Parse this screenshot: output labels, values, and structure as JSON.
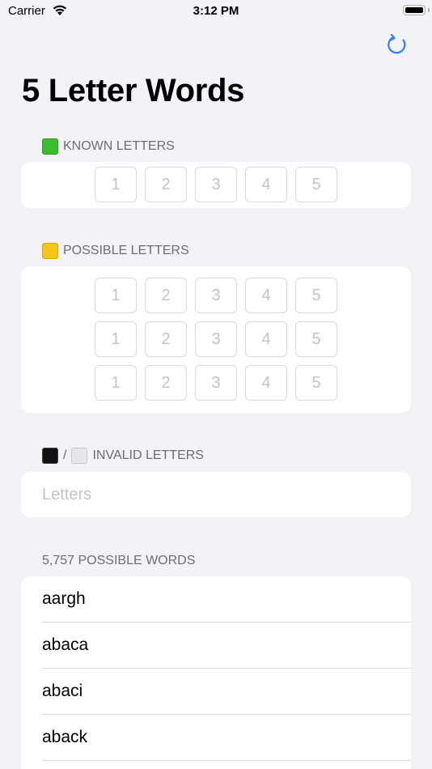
{
  "status_bar": {
    "carrier": "Carrier",
    "time": "3:12 PM"
  },
  "nav": {
    "title": "5 Letter Words",
    "refresh_icon": "refresh-icon",
    "accent_color": "#2f7ff5"
  },
  "known": {
    "header": "KNOWN LETTERS",
    "swatch": "green-square",
    "placeholders": [
      "1",
      "2",
      "3",
      "4",
      "5"
    ]
  },
  "possible": {
    "header": "POSSIBLE LETTERS",
    "swatch": "yellow-square",
    "rows": [
      [
        "1",
        "2",
        "3",
        "4",
        "5"
      ],
      [
        "1",
        "2",
        "3",
        "4",
        "5"
      ],
      [
        "1",
        "2",
        "3",
        "4",
        "5"
      ]
    ]
  },
  "invalid": {
    "header": "INVALID LETTERS",
    "swatch_separator": "/",
    "placeholder": "Letters"
  },
  "words": {
    "header": "5,757 POSSIBLE WORDS",
    "items": [
      "aargh",
      "abaca",
      "abaci",
      "aback"
    ]
  }
}
